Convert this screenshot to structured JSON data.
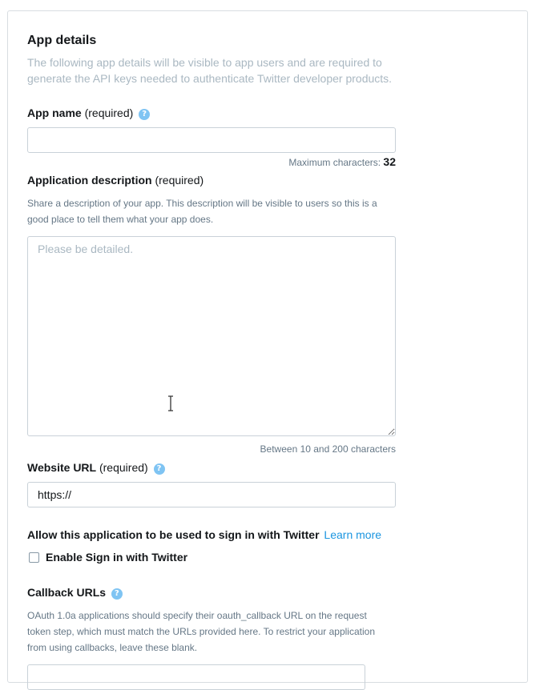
{
  "section": {
    "title": "App details",
    "intro": "The following app details will be visible to app users and are required to generate the API keys needed to authenticate Twitter developer products."
  },
  "app_name": {
    "label": "App name",
    "required": "(required)",
    "help_icon": "?",
    "value": "",
    "max_chars_label": "Maximum characters:",
    "max_chars_value": "32"
  },
  "app_description": {
    "label": "Application description",
    "required": "(required)",
    "help_text": "Share a description of your app. This description will be visible to users so this is a good place to tell them what your app does.",
    "placeholder": "Please be detailed.",
    "length_hint": "Between 10 and 200 characters"
  },
  "website_url": {
    "label": "Website URL",
    "required": "(required)",
    "help_icon": "?",
    "value": "https://"
  },
  "sign_in": {
    "label": "Allow this application to be used to sign in with Twitter",
    "learn_more": "Learn more",
    "checkbox_label": "Enable Sign in with Twitter",
    "checked": false
  },
  "callback_urls": {
    "label": "Callback URLs",
    "help_icon": "?",
    "help_text": "OAuth 1.0a applications should specify their oauth_callback URL on the request token step, which must match the URLs provided here. To restrict your application from using callbacks, leave these blank."
  },
  "colors": {
    "accent": "#1b95e0",
    "help_icon": "#7fc4f3",
    "muted_text": "#aab8c2",
    "secondary_text": "#657786",
    "border": "#c9d1d8"
  },
  "icons": {
    "help": "question-circle-icon",
    "cursor": "text-cursor-icon",
    "checkbox": "checkbox-unchecked"
  }
}
